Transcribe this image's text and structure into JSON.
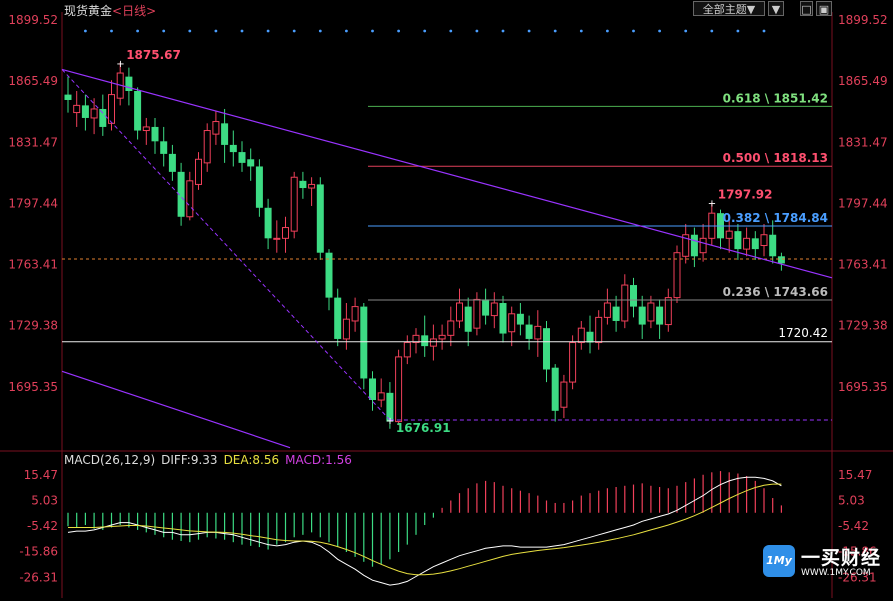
{
  "header": {
    "instrument": "现货黄金",
    "period": "<日线>",
    "theme_button": "全部主题▼",
    "btn_down": "▼",
    "btn_square": "□",
    "btn_close": "▣"
  },
  "macd": {
    "label": "MACD(26,12,9)",
    "diff": "DIFF:9.33",
    "dea": "DEA:8.56",
    "macd": "MACD:1.56"
  },
  "colors": {
    "up": "#f0405a",
    "down": "#3ddc84",
    "trend": "#9933ff",
    "fib_green": "#4caf50",
    "fib_red": "#e0405a",
    "fib_blue": "#4a9eff",
    "diff_line": "#ffffff",
    "dea_line": "#e8e040",
    "axis_text": "#e0405a",
    "dot": "#4a9eff"
  },
  "logo": {
    "name": "一买财经",
    "url": "WWW.1MY.COM",
    "badge": "1My"
  },
  "chart_data": {
    "type": "candlestick",
    "y_ticks": [
      "1899.52",
      "1865.49",
      "1831.47",
      "1797.44",
      "1763.41",
      "1729.38",
      "1695.35"
    ],
    "ylim": [
      1661.3,
      1899.52
    ],
    "macd_ticks": [
      "15.47",
      "5.03",
      "-5.42",
      "-15.86",
      "-26.31"
    ],
    "macd_ylim": [
      -31.5,
      20.7
    ],
    "candles": [
      [
        1858,
        1855,
        1868,
        1848
      ],
      [
        1848,
        1852,
        1860,
        1840
      ],
      [
        1852,
        1845,
        1858,
        1838
      ],
      [
        1845,
        1850,
        1856,
        1836
      ],
      [
        1850,
        1840,
        1858,
        1835
      ],
      [
        1842,
        1858,
        1866,
        1838
      ],
      [
        1856,
        1870,
        1876,
        1852
      ],
      [
        1868,
        1860,
        1873,
        1852
      ],
      [
        1860,
        1838,
        1862,
        1833
      ],
      [
        1838,
        1840,
        1845,
        1830
      ],
      [
        1840,
        1832,
        1845,
        1825
      ],
      [
        1832,
        1825,
        1840,
        1818
      ],
      [
        1825,
        1815,
        1830,
        1810
      ],
      [
        1815,
        1790,
        1820,
        1785
      ],
      [
        1790,
        1810,
        1815,
        1788
      ],
      [
        1808,
        1822,
        1826,
        1805
      ],
      [
        1820,
        1838,
        1842,
        1815
      ],
      [
        1836,
        1843,
        1849,
        1830
      ],
      [
        1842,
        1830,
        1850,
        1820
      ],
      [
        1830,
        1826,
        1838,
        1818
      ],
      [
        1826,
        1820,
        1832,
        1815
      ],
      [
        1822,
        1818,
        1828,
        1810
      ],
      [
        1818,
        1795,
        1822,
        1790
      ],
      [
        1795,
        1778,
        1800,
        1772
      ],
      [
        1778,
        1778,
        1788,
        1770
      ],
      [
        1778,
        1784,
        1790,
        1770
      ],
      [
        1782,
        1812,
        1815,
        1778
      ],
      [
        1810,
        1806,
        1815,
        1800
      ],
      [
        1806,
        1808,
        1812,
        1796
      ],
      [
        1808,
        1770,
        1812,
        1766
      ],
      [
        1770,
        1745,
        1772,
        1738
      ],
      [
        1745,
        1722,
        1750,
        1718
      ],
      [
        1722,
        1733,
        1742,
        1716
      ],
      [
        1732,
        1740,
        1745,
        1726
      ],
      [
        1740,
        1700,
        1742,
        1694
      ],
      [
        1700,
        1688,
        1704,
        1682
      ],
      [
        1688,
        1692,
        1700,
        1684
      ],
      [
        1692,
        1676,
        1698,
        1672
      ],
      [
        1676,
        1712,
        1716,
        1674
      ],
      [
        1712,
        1720,
        1724,
        1708
      ],
      [
        1720,
        1724,
        1728,
        1714
      ],
      [
        1724,
        1718,
        1735,
        1712
      ],
      [
        1718,
        1722,
        1730,
        1710
      ],
      [
        1722,
        1724,
        1730,
        1716
      ],
      [
        1724,
        1732,
        1740,
        1718
      ],
      [
        1732,
        1742,
        1750,
        1728
      ],
      [
        1740,
        1726,
        1745,
        1718
      ],
      [
        1728,
        1744,
        1748,
        1724
      ],
      [
        1744,
        1735,
        1750,
        1730
      ],
      [
        1735,
        1742,
        1748,
        1728
      ],
      [
        1742,
        1725,
        1746,
        1720
      ],
      [
        1726,
        1736,
        1740,
        1718
      ],
      [
        1736,
        1730,
        1742,
        1724
      ],
      [
        1730,
        1722,
        1735,
        1716
      ],
      [
        1722,
        1729,
        1738,
        1712
      ],
      [
        1728,
        1705,
        1732,
        1698
      ],
      [
        1706,
        1682,
        1708,
        1676
      ],
      [
        1684,
        1698,
        1702,
        1678
      ],
      [
        1698,
        1720,
        1724,
        1694
      ],
      [
        1720,
        1728,
        1732,
        1716
      ],
      [
        1726,
        1720,
        1735,
        1714
      ],
      [
        1720,
        1734,
        1738,
        1716
      ],
      [
        1734,
        1742,
        1750,
        1730
      ],
      [
        1740,
        1732,
        1746,
        1726
      ],
      [
        1732,
        1752,
        1758,
        1728
      ],
      [
        1752,
        1740,
        1756,
        1734
      ],
      [
        1740,
        1730,
        1746,
        1722
      ],
      [
        1732,
        1742,
        1746,
        1728
      ],
      [
        1740,
        1730,
        1744,
        1722
      ],
      [
        1730,
        1745,
        1750,
        1726
      ],
      [
        1745,
        1770,
        1774,
        1742
      ],
      [
        1768,
        1780,
        1786,
        1764
      ],
      [
        1780,
        1768,
        1784,
        1762
      ],
      [
        1770,
        1778,
        1786,
        1765
      ],
      [
        1778,
        1792,
        1798,
        1774
      ],
      [
        1792,
        1778,
        1794,
        1772
      ],
      [
        1778,
        1782,
        1788,
        1770
      ],
      [
        1782,
        1772,
        1786,
        1766
      ],
      [
        1772,
        1778,
        1784,
        1768
      ],
      [
        1778,
        1772,
        1782,
        1766
      ],
      [
        1774,
        1780,
        1786,
        1768
      ],
      [
        1780,
        1768,
        1788,
        1764
      ],
      [
        1768,
        1764,
        1770,
        1760
      ]
    ],
    "annotations": [
      {
        "text": "1875.67",
        "price": 1875.67,
        "index": 6,
        "color": "red"
      },
      {
        "text": "1797.92",
        "price": 1797.92,
        "index": 74,
        "color": "red"
      },
      {
        "text": "1676.91",
        "price": 1676.91,
        "index": 37,
        "color": "green"
      }
    ],
    "fib_levels": [
      {
        "label": "0.618 \\ 1851.42",
        "price": 1851.42,
        "color": "green"
      },
      {
        "label": "0.500 \\ 1818.13",
        "price": 1818.13,
        "color": "red"
      },
      {
        "label": "0.382 \\ 1784.84",
        "price": 1784.84,
        "color": "blue"
      },
      {
        "label": "0.236 \\ 1743.66",
        "price": 1743.66,
        "color": "gray"
      }
    ],
    "h_line": {
      "label": "1720.42",
      "price": 1720.42
    },
    "dashed_current": 1766.5,
    "dashed_low": 1676.91,
    "macd_bars": [
      -5.5,
      -6,
      -5,
      -6.5,
      -7,
      -6,
      -5,
      -6,
      -7,
      -8,
      -9,
      -10,
      -11,
      -11.5,
      -12,
      -11,
      -10,
      -10.5,
      -11,
      -12,
      -13,
      -13.5,
      -14,
      -15,
      -13,
      -12,
      -10,
      -9,
      -8,
      -10,
      -12,
      -14,
      -16,
      -18,
      -20,
      -22,
      -21,
      -19,
      -16,
      -13,
      -9,
      -5,
      -2,
      2,
      5,
      8,
      10,
      12,
      13,
      12.5,
      11,
      10,
      9,
      8,
      7,
      5,
      4,
      4,
      5,
      7,
      8,
      9,
      10,
      10.5,
      11,
      11.5,
      12,
      11,
      10.5,
      10,
      11,
      12.5,
      14,
      15.5,
      16.5,
      17,
      16.5,
      16,
      15,
      13,
      10,
      6,
      3
    ],
    "diff": [
      -8,
      -7.5,
      -7.5,
      -7,
      -6,
      -5,
      -4,
      -4,
      -5,
      -6,
      -7,
      -8,
      -8,
      -9,
      -9,
      -8.5,
      -8,
      -8,
      -8.5,
      -9,
      -10,
      -11,
      -12,
      -13,
      -13.5,
      -13,
      -12,
      -11.5,
      -12,
      -13.5,
      -16,
      -19,
      -21,
      -23,
      -25.5,
      -27.5,
      -28.5,
      -29.5,
      -29,
      -28,
      -26,
      -24,
      -22,
      -20.5,
      -19,
      -17.5,
      -16.5,
      -15.5,
      -14.5,
      -14,
      -13.5,
      -13.5,
      -14,
      -14,
      -14,
      -14,
      -13.5,
      -13,
      -12,
      -11,
      -10,
      -9,
      -8,
      -7,
      -6,
      -5,
      -3.5,
      -2.5,
      -1.5,
      -0.5,
      1,
      3,
      5,
      7,
      9.5,
      11.5,
      13,
      14,
      14.5,
      14.5,
      14,
      13,
      11
    ],
    "dea": [
      -6,
      -6,
      -6,
      -6,
      -5.8,
      -5.6,
      -5.4,
      -5.2,
      -5.2,
      -5.4,
      -5.8,
      -6.2,
      -6.6,
      -7,
      -7.4,
      -7.6,
      -7.8,
      -7.9,
      -8,
      -8.3,
      -8.8,
      -9.3,
      -9.8,
      -10.4,
      -11,
      -11.3,
      -11.5,
      -11.5,
      -11.6,
      -12,
      -12.8,
      -13.8,
      -15,
      -16.3,
      -17.8,
      -19.5,
      -21,
      -22.5,
      -23.8,
      -24.8,
      -25.3,
      -25.3,
      -25,
      -24.5,
      -23.7,
      -22.8,
      -21.8,
      -20.8,
      -19.8,
      -18.8,
      -17.8,
      -17,
      -16.4,
      -15.9,
      -15.4,
      -15,
      -14.6,
      -14.2,
      -13.7,
      -13.2,
      -12.6,
      -12,
      -11.3,
      -10.6,
      -9.8,
      -9,
      -8,
      -7,
      -6,
      -5,
      -3.8,
      -2.6,
      -1.2,
      0.4,
      2.2,
      4,
      5.8,
      7.5,
      9,
      10.3,
      11.2,
      11.7,
      11.7
    ]
  }
}
